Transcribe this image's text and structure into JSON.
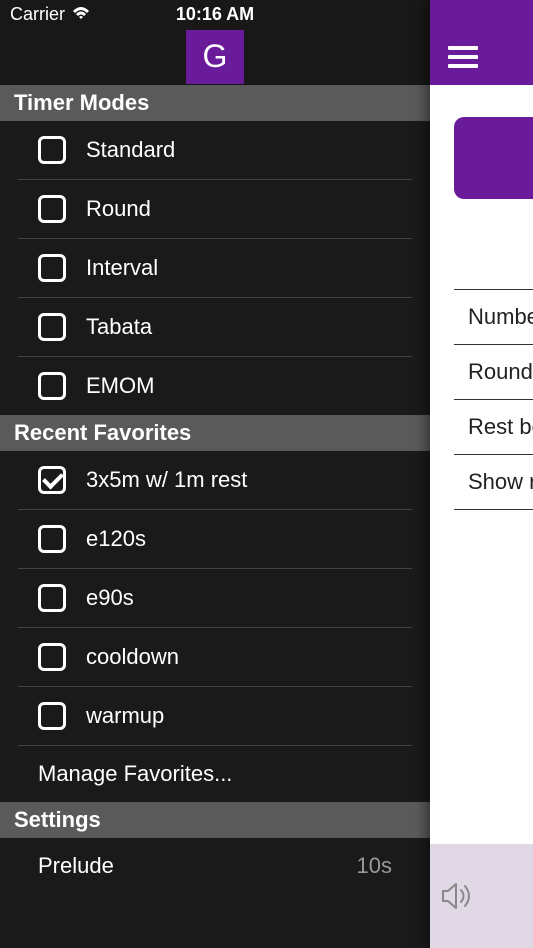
{
  "status_bar": {
    "carrier": "Carrier",
    "time": "10:16 AM"
  },
  "logo": {
    "text": "G"
  },
  "sections": {
    "timer_modes": {
      "header": "Timer Modes",
      "items": [
        {
          "label": "Standard",
          "checked": false
        },
        {
          "label": "Round",
          "checked": false
        },
        {
          "label": "Interval",
          "checked": false
        },
        {
          "label": "Tabata",
          "checked": false
        },
        {
          "label": "EMOM",
          "checked": false
        }
      ]
    },
    "recent_favorites": {
      "header": "Recent Favorites",
      "items": [
        {
          "label": "3x5m w/ 1m rest",
          "checked": true
        },
        {
          "label": "e120s",
          "checked": false
        },
        {
          "label": "e90s",
          "checked": false
        },
        {
          "label": "cooldown",
          "checked": false
        },
        {
          "label": "warmup",
          "checked": false
        }
      ],
      "manage": "Manage Favorites..."
    },
    "settings": {
      "header": "Settings",
      "items": [
        {
          "label": "Prelude",
          "value": "10s"
        }
      ]
    }
  },
  "right_panel": {
    "rows": [
      "Number",
      "Round d",
      "Rest bet",
      "Show ro"
    ]
  }
}
